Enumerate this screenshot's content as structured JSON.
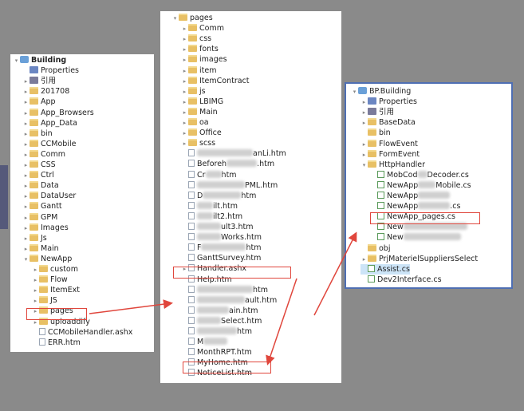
{
  "panel1": {
    "items": [
      {
        "label": "Building",
        "kind": "proj",
        "arrow": "▾",
        "indent": 0,
        "bold": true
      },
      {
        "label": "Properties",
        "kind": "props",
        "arrow": "",
        "indent": 1
      },
      {
        "label": "引用",
        "kind": "ref",
        "arrow": "▸",
        "indent": 1
      },
      {
        "label": "201708",
        "kind": "folder",
        "arrow": "▸",
        "indent": 1
      },
      {
        "label": "App",
        "kind": "folder",
        "arrow": "▸",
        "indent": 1
      },
      {
        "label": "App_Browsers",
        "kind": "folder",
        "arrow": "▸",
        "indent": 1
      },
      {
        "label": "App_Data",
        "kind": "folder",
        "arrow": "▸",
        "indent": 1
      },
      {
        "label": "bin",
        "kind": "folder",
        "arrow": "▸",
        "indent": 1
      },
      {
        "label": "CCMobile",
        "kind": "folder",
        "arrow": "▸",
        "indent": 1
      },
      {
        "label": "Comm",
        "kind": "folder",
        "arrow": "▸",
        "indent": 1
      },
      {
        "label": "CSS",
        "kind": "folder",
        "arrow": "▸",
        "indent": 1
      },
      {
        "label": "Ctrl",
        "kind": "folder",
        "arrow": "▸",
        "indent": 1
      },
      {
        "label": "Data",
        "kind": "folder",
        "arrow": "▸",
        "indent": 1
      },
      {
        "label": "DataUser",
        "kind": "folder",
        "arrow": "▸",
        "indent": 1
      },
      {
        "label": "Gantt",
        "kind": "folder",
        "arrow": "▸",
        "indent": 1
      },
      {
        "label": "GPM",
        "kind": "folder",
        "arrow": "▸",
        "indent": 1
      },
      {
        "label": "Images",
        "kind": "folder",
        "arrow": "▸",
        "indent": 1
      },
      {
        "label": "Js",
        "kind": "folder",
        "arrow": "▸",
        "indent": 1
      },
      {
        "label": "Main",
        "kind": "folder",
        "arrow": "▸",
        "indent": 1
      },
      {
        "label": "NewApp",
        "kind": "folder",
        "arrow": "▾",
        "indent": 1
      },
      {
        "label": "custom",
        "kind": "folder",
        "arrow": "▸",
        "indent": 2
      },
      {
        "label": "Flow",
        "kind": "folder",
        "arrow": "▸",
        "indent": 2
      },
      {
        "label": "ItemExt",
        "kind": "folder",
        "arrow": "▸",
        "indent": 2
      },
      {
        "label": "JS",
        "kind": "folder",
        "arrow": "▸",
        "indent": 2
      },
      {
        "label": "pages",
        "kind": "folder",
        "arrow": "▸",
        "indent": 2
      },
      {
        "label": "uploaddify",
        "kind": "folder",
        "arrow": "▸",
        "indent": 2
      },
      {
        "label": "CCMobileHandler.ashx",
        "kind": "file",
        "arrow": "",
        "indent": 2
      },
      {
        "label": "ERR.htm",
        "kind": "file",
        "arrow": "",
        "indent": 2
      }
    ]
  },
  "panel2": {
    "items": [
      {
        "label": "pages",
        "kind": "folder",
        "arrow": "▾",
        "indent": 0
      },
      {
        "label": "Comm",
        "kind": "folder",
        "arrow": "▸",
        "indent": 1
      },
      {
        "label": "css",
        "kind": "folder",
        "arrow": "▸",
        "indent": 1
      },
      {
        "label": "fonts",
        "kind": "folder",
        "arrow": "▸",
        "indent": 1
      },
      {
        "label": "images",
        "kind": "folder",
        "arrow": "▸",
        "indent": 1
      },
      {
        "label": "item",
        "kind": "folder",
        "arrow": "▸",
        "indent": 1
      },
      {
        "label": "ItemContract",
        "kind": "folder",
        "arrow": "▸",
        "indent": 1
      },
      {
        "label": "js",
        "kind": "folder",
        "arrow": "▸",
        "indent": 1
      },
      {
        "label": "LBIMG",
        "kind": "folder",
        "arrow": "▸",
        "indent": 1
      },
      {
        "label": "Main",
        "kind": "folder",
        "arrow": "▸",
        "indent": 1
      },
      {
        "label": "oa",
        "kind": "folder",
        "arrow": "▸",
        "indent": 1
      },
      {
        "label": "Office",
        "kind": "folder",
        "arrow": "▸",
        "indent": 1
      },
      {
        "label": "scss",
        "kind": "folder",
        "arrow": "▸",
        "indent": 1
      },
      {
        "label": "anLi.htm",
        "kind": "file",
        "arrow": "",
        "indent": 1,
        "blurPre": 70
      },
      {
        "label": "Beforeh",
        "kind": "file",
        "arrow": "",
        "indent": 1,
        "blurPost": 38,
        "tail": ".htm"
      },
      {
        "label": "Cr",
        "kind": "file",
        "arrow": "",
        "indent": 1,
        "blurPost": 20,
        "tail": "htm"
      },
      {
        "label": "PML.htm",
        "kind": "file",
        "arrow": "",
        "indent": 1,
        "blurPre": 60
      },
      {
        "label": "D",
        "kind": "file",
        "arrow": "",
        "indent": 1,
        "blurPost": 48,
        "tail": "htm"
      },
      {
        "label": "ilt.htm",
        "kind": "file",
        "arrow": "",
        "indent": 1,
        "blurPre": 20
      },
      {
        "label": "ilt2.htm",
        "kind": "file",
        "arrow": "",
        "indent": 1,
        "blurPre": 20
      },
      {
        "label": "ult3.htm",
        "kind": "file",
        "arrow": "",
        "indent": 1,
        "blurPre": 30
      },
      {
        "label": "Works.htm",
        "kind": "file",
        "arrow": "",
        "indent": 1,
        "blurPre": 30
      },
      {
        "label": "F",
        "kind": "file",
        "arrow": "",
        "indent": 1,
        "blurPost": 56,
        "tail": "htm"
      },
      {
        "label": "GanttSurvey.htm",
        "kind": "file",
        "arrow": "",
        "indent": 1
      },
      {
        "label": "Handler.ashx",
        "kind": "file",
        "arrow": "▸",
        "indent": 1
      },
      {
        "label": "Help.htm",
        "kind": "file",
        "arrow": "",
        "indent": 1
      },
      {
        "label": "htm",
        "kind": "file",
        "arrow": "",
        "indent": 1,
        "blurPre": 70
      },
      {
        "label": "ault.htm",
        "kind": "file",
        "arrow": "",
        "indent": 1,
        "blurPre": 60
      },
      {
        "label": "ain.htm",
        "kind": "file",
        "arrow": "",
        "indent": 1,
        "blurPre": 40
      },
      {
        "label": "Select.htm",
        "kind": "file",
        "arrow": "",
        "indent": 1,
        "blurPre": 30
      },
      {
        "label": "htm",
        "kind": "file",
        "arrow": "",
        "indent": 1,
        "blurPre": 50
      },
      {
        "label": "M",
        "kind": "file",
        "arrow": "",
        "indent": 1,
        "blurPost": 30
      },
      {
        "label": "MonthRPT.htm",
        "kind": "file",
        "arrow": "",
        "indent": 1
      },
      {
        "label": "MyHome.htm",
        "kind": "file",
        "arrow": "",
        "indent": 1
      },
      {
        "label": "NoticeList.htm",
        "kind": "file",
        "arrow": "",
        "indent": 1
      }
    ]
  },
  "panel3": {
    "items": [
      {
        "label": "BP.Building",
        "kind": "proj",
        "arrow": "▾",
        "indent": 0
      },
      {
        "label": "Properties",
        "kind": "props",
        "arrow": "▸",
        "indent": 1
      },
      {
        "label": "引用",
        "kind": "ref",
        "arrow": "▸",
        "indent": 1
      },
      {
        "label": "BaseData",
        "kind": "folder",
        "arrow": "▸",
        "indent": 1
      },
      {
        "label": "bin",
        "kind": "folder",
        "arrow": "",
        "indent": 1
      },
      {
        "label": "FlowEvent",
        "kind": "folder",
        "arrow": "▸",
        "indent": 1
      },
      {
        "label": "FormEvent",
        "kind": "folder",
        "arrow": "▸",
        "indent": 1
      },
      {
        "label": "HttpHandler",
        "kind": "folder",
        "arrow": "▾",
        "indent": 1
      },
      {
        "label": "MobCod",
        "kind": "cs",
        "arrow": "",
        "indent": 2,
        "blurPost": 12,
        "tail": "Decoder.cs"
      },
      {
        "label": "NewApp",
        "kind": "cs",
        "arrow": "",
        "indent": 2,
        "blurPost": 22,
        "tail": "Mobile.cs"
      },
      {
        "label": "NewApp",
        "kind": "cs",
        "arrow": "",
        "indent": 2,
        "blurPost": 40
      },
      {
        "label": "NewApp",
        "kind": "cs",
        "arrow": "",
        "indent": 2,
        "blurPost": 40,
        "tail": ".cs"
      },
      {
        "label": "NewApp_pages.cs",
        "kind": "cs",
        "arrow": "",
        "indent": 2
      },
      {
        "label": "New",
        "kind": "cs",
        "arrow": "",
        "indent": 2,
        "blurPost": 80
      },
      {
        "label": "New",
        "kind": "cs",
        "arrow": "",
        "indent": 2,
        "blurPost": 72
      },
      {
        "label": "obj",
        "kind": "folder",
        "arrow": "",
        "indent": 1
      },
      {
        "label": "PrjMaterielSuppliersSelect",
        "kind": "folder",
        "arrow": "▸",
        "indent": 1
      },
      {
        "label": "Assist.cs",
        "kind": "cs",
        "arrow": "",
        "indent": 1,
        "selected": true
      },
      {
        "label": "Dev2Interface.cs",
        "kind": "cs",
        "arrow": "",
        "indent": 1
      }
    ]
  },
  "highlights": {
    "p1": "pages",
    "p2a": "Handler.ashx",
    "p2b": "MyHome.htm",
    "p3": "NewApp_pages.cs"
  },
  "colors": {
    "highlight": "#e0463c",
    "folder": "#e8c065",
    "selection": "#cce4f7"
  }
}
